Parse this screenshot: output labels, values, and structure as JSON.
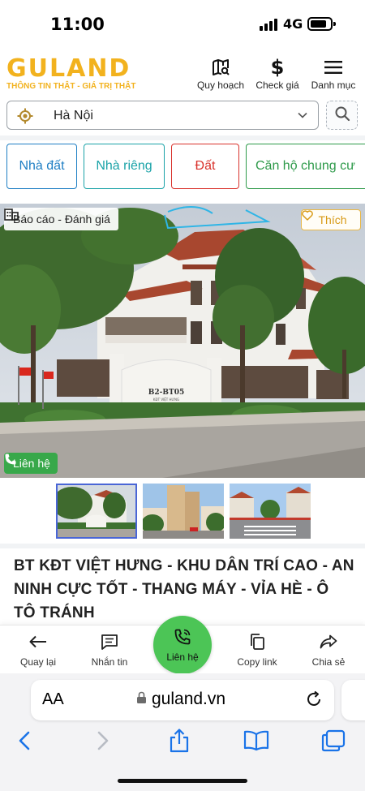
{
  "status": {
    "time": "11:00",
    "network": "4G"
  },
  "header": {
    "logo_text": "GULAND",
    "logo_tagline": "THÔNG TIN THẬT - GIÁ TRỊ THẬT",
    "nav": [
      {
        "label": "Quy hoạch",
        "icon": "map-search-icon"
      },
      {
        "label": "Check giá",
        "icon": "dollar-icon"
      },
      {
        "label": "Danh mục",
        "icon": "menu-icon"
      }
    ]
  },
  "search": {
    "location": "Hà Nội"
  },
  "categories": [
    {
      "label": "Nhà đất",
      "color": "#1f7fc4"
    },
    {
      "label": "Nhà riêng",
      "color": "#1ba3a8"
    },
    {
      "label": "Đất",
      "color": "#d9322c"
    },
    {
      "label": "Căn hộ chung cư",
      "color": "#2e9a4a"
    }
  ],
  "hero": {
    "report_label": "Báo cáo - Đánh giá",
    "like_label": "Thích",
    "contact_label": "Liên hệ",
    "gate_sign": "B2-BT05",
    "gate_sub": "KĐT VIỆT HƯNG"
  },
  "thumbnails": [
    {
      "name": "villa-corner",
      "active": true
    },
    {
      "name": "apartment-tower",
      "active": false
    },
    {
      "name": "street-view",
      "active": false
    }
  ],
  "listing": {
    "title": "BT KĐT VIỆT HƯNG - KHU DÂN TRÍ CAO - AN NINH CỰC TỐT - THANG MÁY - VỈA HÈ - Ô TÔ TRÁNH"
  },
  "actions": {
    "back": "Quay lại",
    "message": "Nhắn tin",
    "contact": "Liên hệ",
    "copy": "Copy link",
    "share": "Chia sẻ"
  },
  "browser": {
    "aa_label": "AA",
    "url": "guland.vn"
  },
  "colors": {
    "brand": "#f2b21e",
    "contact_green": "#38a84a",
    "contact_circle": "#4cc556",
    "ios_blue": "#1a73e8"
  }
}
